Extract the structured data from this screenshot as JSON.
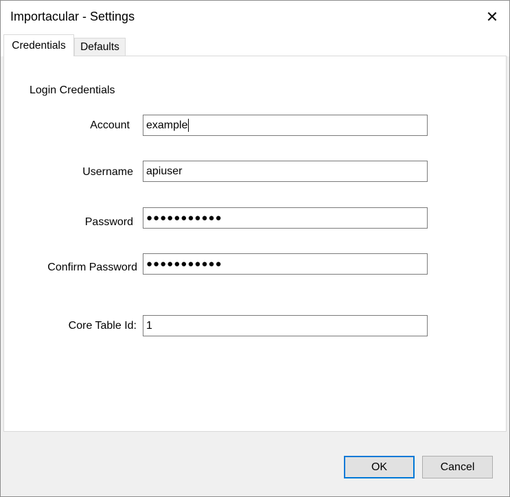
{
  "window": {
    "title": "Importacular - Settings",
    "close_glyph": "✕"
  },
  "tabs": [
    {
      "label": "Credentials",
      "active": true
    },
    {
      "label": "Defaults",
      "active": false
    }
  ],
  "credentials": {
    "section_title": "Login Credentials",
    "account": {
      "label": "Account",
      "value": "example"
    },
    "username": {
      "label": "Username",
      "value": "apiuser"
    },
    "password": {
      "label": "Password",
      "value": "●●●●●●●●●●●"
    },
    "confirm_password": {
      "label": "Confirm Password",
      "value": "●●●●●●●●●●●"
    },
    "core_table_id": {
      "label": "Core Table Id:",
      "value": "1"
    }
  },
  "buttons": {
    "ok": "OK",
    "cancel": "Cancel"
  },
  "colors": {
    "focus_accent": "#0078d7",
    "dialog_bg": "#f0f0f0"
  }
}
